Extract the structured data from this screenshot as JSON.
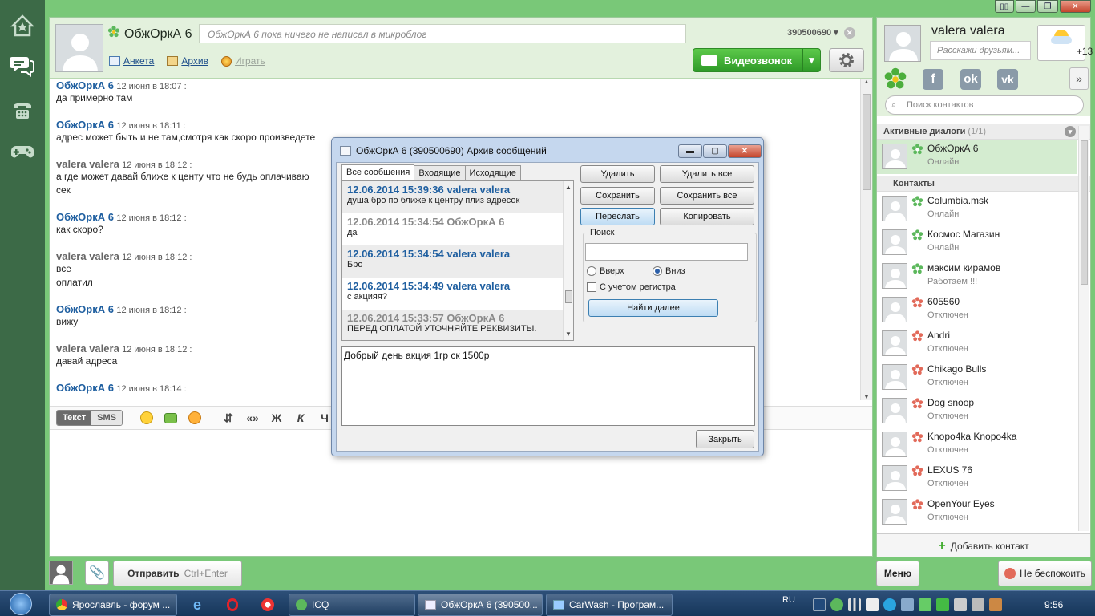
{
  "chat": {
    "contact_name": "ОбжОркА 6",
    "microblog_placeholder": "ОбжОркА 6 пока ничего не написал в микроблог",
    "uin": "390500690",
    "links": {
      "profile": "Анкета",
      "archive": "Архив",
      "play": "Играть"
    },
    "video_call": "Видеозвонок",
    "messages": [
      {
        "author": "ОбжОркА 6",
        "time": "12 июня в 18:07 :",
        "lines": [
          "да примерно там"
        ]
      },
      {
        "author": "ОбжОркА 6",
        "time": "12 июня в 18:11 :",
        "lines": [
          "адрес может быть и не там,смотря как скоро произведете"
        ]
      },
      {
        "author": "valera valera",
        "time": "12 июня в 18:12 :",
        "lines": [
          "а где может давай ближе к центу что не будь оплачиваю",
          "сек"
        ]
      },
      {
        "author": "ОбжОркА 6",
        "time": "12 июня в 18:12 :",
        "lines": [
          "как скоро?"
        ]
      },
      {
        "author": "valera valera",
        "time": "12 июня в 18:12 :",
        "lines": [
          "все",
          "оплатил"
        ]
      },
      {
        "author": "ОбжОркА 6",
        "time": "12 июня в 18:12 :",
        "lines": [
          "вижу"
        ]
      },
      {
        "author": "valera valera",
        "time": "12 июня в 18:12 :",
        "lines": [
          "давай адреса"
        ]
      },
      {
        "author": "ОбжОркА 6",
        "time": "12 июня в 18:14 :",
        "lines": []
      }
    ],
    "toolbar": {
      "text_mode": "Текст",
      "sms_mode": "SMS",
      "bold": "Ж",
      "italic": "К",
      "underline": "Ч",
      "quote": "«»"
    },
    "send_label": "Отправить",
    "send_hotkey": "Ctrl+Enter"
  },
  "sidebar": {
    "user_name": "valera valera",
    "status_placeholder": "Расскажи друзьям...",
    "weather_temp": "+13",
    "search_placeholder": "Поиск контактов",
    "active_section": "Активные диалоги",
    "active_count": "(1/1)",
    "contacts_section": "Контакты",
    "active_dialogs": [
      {
        "name": "ОбжОркА 6",
        "status": "Онлайн",
        "online": true
      }
    ],
    "contacts": [
      {
        "name": "Columbia.msk",
        "status": "Онлайн",
        "online": true
      },
      {
        "name": "Космос Магазин",
        "status": "Онлайн",
        "online": true
      },
      {
        "name": "максим кирамов",
        "status": "Работаем !!!",
        "online": true
      },
      {
        "name": "605560",
        "status": "Отключен",
        "online": false
      },
      {
        "name": "Andri",
        "status": "Отключен",
        "online": false
      },
      {
        "name": "Chikago Bulls",
        "status": "Отключен",
        "online": false
      },
      {
        "name": "Dog snoop",
        "status": "Отключен",
        "online": false
      },
      {
        "name": "Knopo4ka Knopo4ka",
        "status": "Отключен",
        "online": false
      },
      {
        "name": "LEXUS 76",
        "status": "Отключен",
        "online": false
      },
      {
        "name": "OpenYour Eyes",
        "status": "Отключен",
        "online": false
      }
    ],
    "add_contact": "Добавить контакт",
    "menu": "Меню",
    "dnd": "Не беспокоить"
  },
  "dialog": {
    "title": "ОбжОркА 6 (390500690) Архив сообщений",
    "tabs": [
      "Все сообщения",
      "Входящие",
      "Исходящие"
    ],
    "entries": [
      {
        "header": "12.06.2014 15:39:36 valera valera",
        "text": "душа бро по ближе к центру плиз адресок",
        "mine": true
      },
      {
        "header": "12.06.2014 15:34:54 ОбжОркА 6",
        "text": "да",
        "mine": false
      },
      {
        "header": "12.06.2014 15:34:54 valera valera",
        "text": "Бро",
        "mine": true
      },
      {
        "header": "12.06.2014 15:34:49 valera valera",
        "text": "с акцияя?",
        "mine": true
      },
      {
        "header": "12.06.2014 15:33:57 ОбжОркА 6",
        "text": "ПЕРЕД ОПЛАТОЙ УТОЧНЯЙТЕ РЕКВИЗИТЫ.",
        "mine": false
      }
    ],
    "buttons": {
      "delete": "Удалить",
      "delete_all": "Удалить все",
      "save": "Сохранить",
      "save_all": "Сохранить все",
      "forward": "Переслать",
      "copy": "Копировать",
      "find_next": "Найти далее",
      "close": "Закрыть"
    },
    "search_label": "Поиск",
    "search_value": "",
    "dir_up": "Вверх",
    "dir_down": "Вниз",
    "match_case": "С учетом регистра",
    "message_text": "Добрый день акция 1гр ск 1500р"
  },
  "taskbar": {
    "tasks": [
      "Ярославль - форум ...",
      "ICQ",
      "ОбжОркА 6 (390500...",
      "CarWash - Програм..."
    ],
    "lang": "RU",
    "clock": "9:56"
  },
  "colors": {
    "accent_green": "#79c878",
    "link_blue": "#1f5fa0",
    "online": "#5cb85c",
    "offline": "#e26a5a"
  }
}
